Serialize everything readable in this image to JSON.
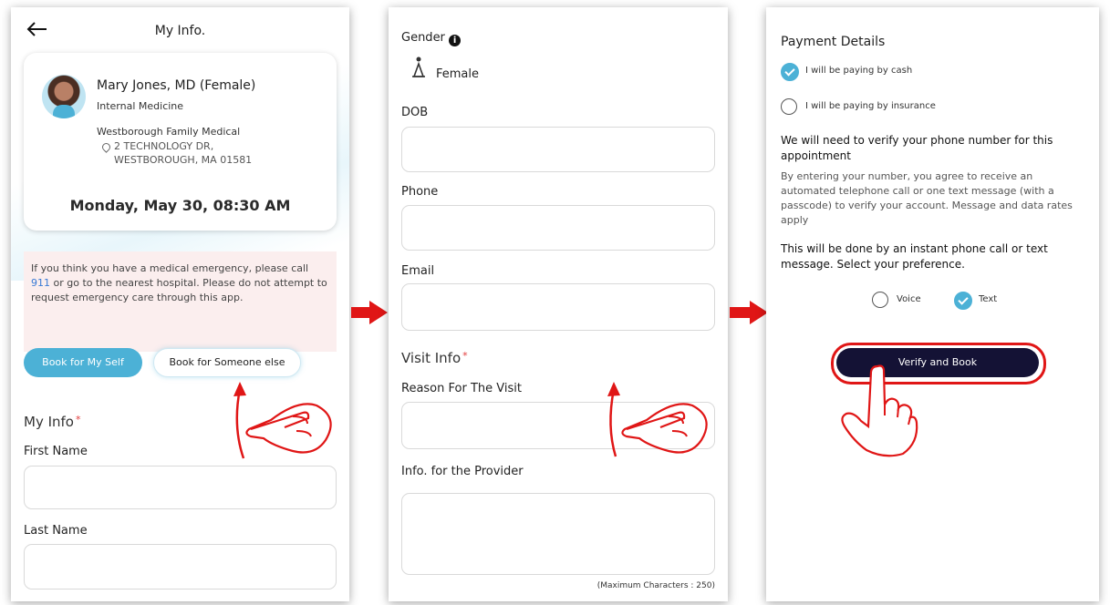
{
  "screen1": {
    "back_icon": "arrow-left-icon",
    "title": "My Info.",
    "doctor": {
      "name": "Mary Jones, MD (Female)",
      "specialty": "Internal Medicine",
      "practice": "Westborough Family Medical",
      "address_line1": "2 TECHNOLOGY DR,",
      "address_line2": "WESTBOROUGH, MA 01581",
      "location_icon": "location-pin-icon"
    },
    "appointment_time": "Monday, May 30, 08:30 AM",
    "emergency_notice": {
      "before_link": "If you think you have a medical emergency, please call ",
      "link": "911",
      "after_link": " or go to the nearest hospital. Please do not attempt to request emergency care through this app."
    },
    "book_self_label": "Book for My Self",
    "book_other_label": "Book for Someone else",
    "my_info_heading": "My Info",
    "required_mark": "*",
    "first_name_label": "First Name",
    "last_name_label": "Last Name"
  },
  "screen2": {
    "gender_label": "Gender",
    "info_icon": "info-icon",
    "gender_value": "Female",
    "gender_icon": "female-icon",
    "dob_label": "DOB",
    "phone_label": "Phone",
    "email_label": "Email",
    "visit_info_heading": "Visit Info",
    "required_mark": "*",
    "reason_label": "Reason For The Visit",
    "provider_info_label": "Info. for the Provider",
    "max_chars_note": "(Maximum Characters : 250)"
  },
  "screen3": {
    "payment_heading": "Payment Details",
    "pay_cash_label": "I will be paying by cash",
    "pay_cash_checked": true,
    "pay_insurance_label": "I will be paying by insurance",
    "pay_insurance_checked": false,
    "verify_heading": "We will need to verify your phone number for this appointment",
    "verify_body": "By entering your number, you agree to receive an automated telephone call or one text message (with a passcode) to verify your account.  Message and data rates apply",
    "preference_text": "This will be done by an instant phone call or text message. Select your preference.",
    "voice_label": "Voice",
    "voice_checked": false,
    "text_label": "Text",
    "text_checked": true,
    "verify_button_label": "Verify and Book"
  },
  "colors": {
    "accent": "#4cb1d6",
    "dark_button": "#141235",
    "highlight_red": "#e01616",
    "emergency_bg": "#fbeeee",
    "link_blue": "#3a7bd5"
  }
}
